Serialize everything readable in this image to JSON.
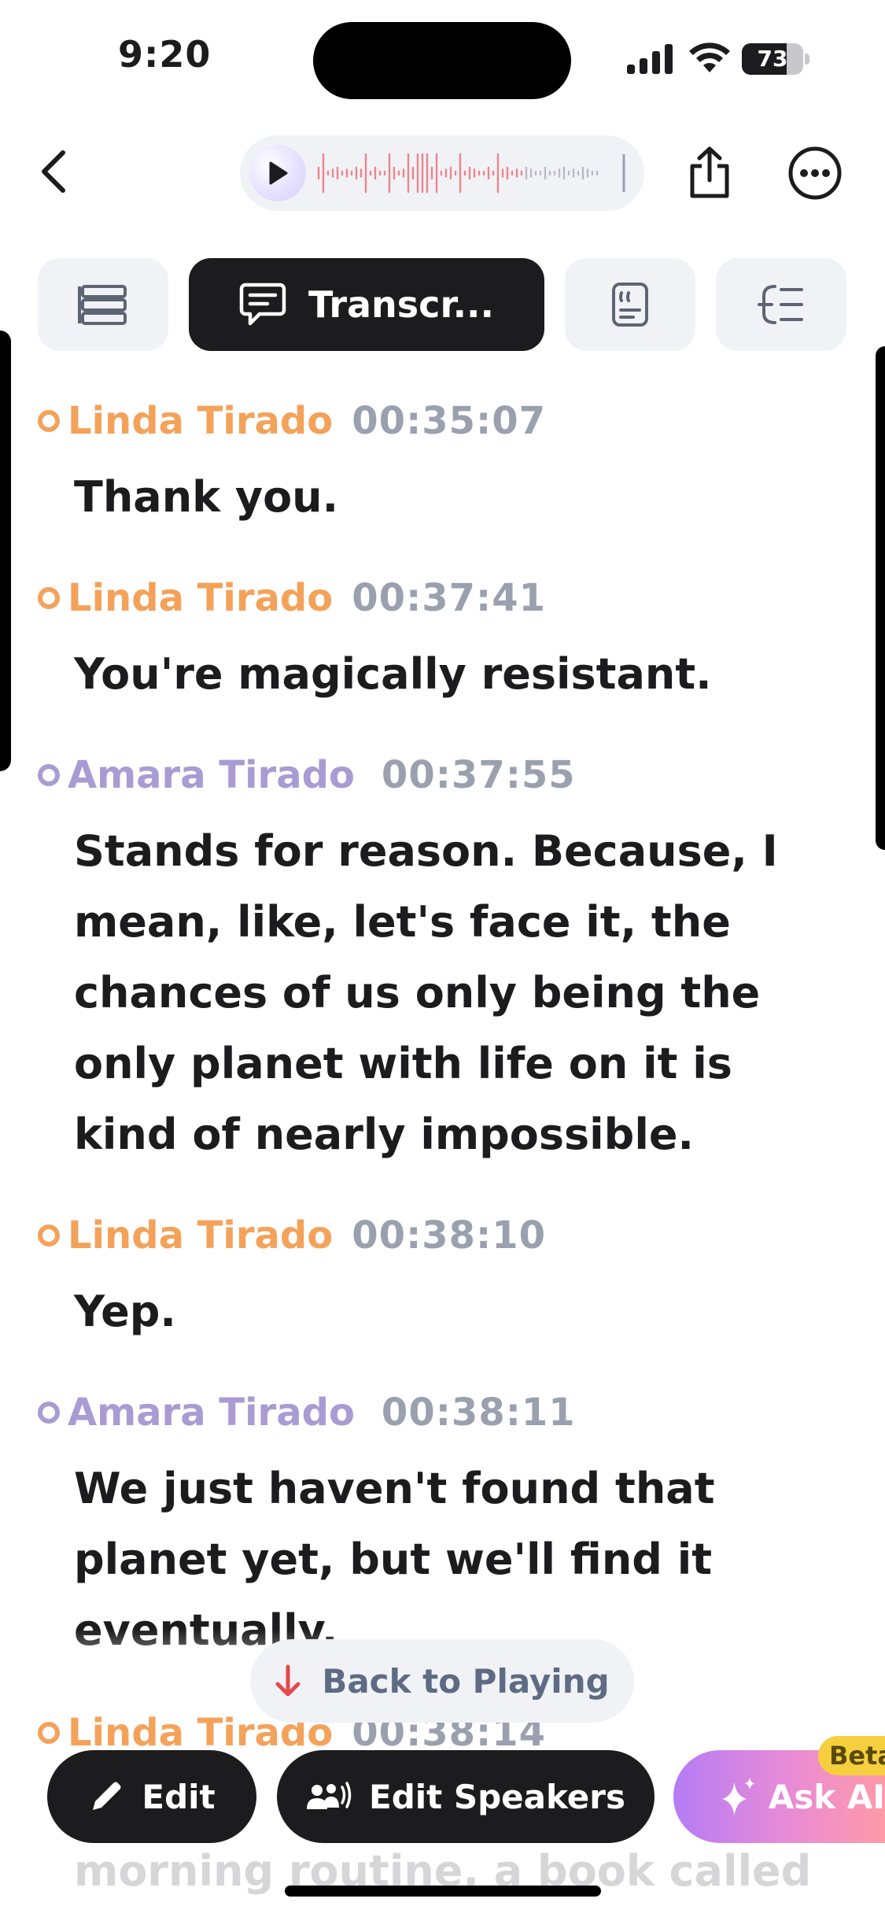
{
  "status_bar": {
    "time": "9:20",
    "battery_level": "73",
    "battery_fraction": 0.73
  },
  "player": {
    "accent_color": "#e9868d"
  },
  "tabs": [
    {
      "name": "summary",
      "icon": "list-icon",
      "label": ""
    },
    {
      "name": "transcript",
      "icon": "chat-bubble-icon",
      "label": "Transcr...",
      "selected": true
    },
    {
      "name": "quotes",
      "icon": "quote-card-icon",
      "label": ""
    },
    {
      "name": "outline",
      "icon": "outline-icon",
      "label": ""
    }
  ],
  "speakers": {
    "linda": {
      "name": "Linda Tirado",
      "color": "#f4a25a"
    },
    "amara": {
      "name": "Amara Tirado",
      "color": "#a99bd3"
    }
  },
  "transcript": [
    {
      "speaker": "Linda Tirado",
      "time": "00:35:07",
      "text": "Thank you."
    },
    {
      "speaker": "Linda Tirado",
      "time": "00:37:41",
      "text": "You're magically resistant."
    },
    {
      "speaker": "Amara Tirado",
      "time": "00:37:55",
      "text": "Stands for reason. Because, I mean, like, let's face it, the chances of us only being the only planet with life on it is kind of nearly impossible."
    },
    {
      "speaker": "Linda Tirado",
      "time": "00:38:10",
      "text": "Yep."
    },
    {
      "speaker": "Amara Tirado",
      "time": "00:38:11",
      "text": "We just haven't found that planet yet, but we'll find it eventually."
    },
    {
      "speaker": "Linda Tirado",
      "time": "00:38:14",
      "text": ""
    }
  ],
  "faded_text": "morning routine, a book called",
  "back_to_playing": "Back to Playing",
  "bottom_bar": {
    "edit": "Edit",
    "edit_speakers": "Edit Speakers",
    "ask_ai": "Ask AI",
    "beta": "Beta"
  }
}
